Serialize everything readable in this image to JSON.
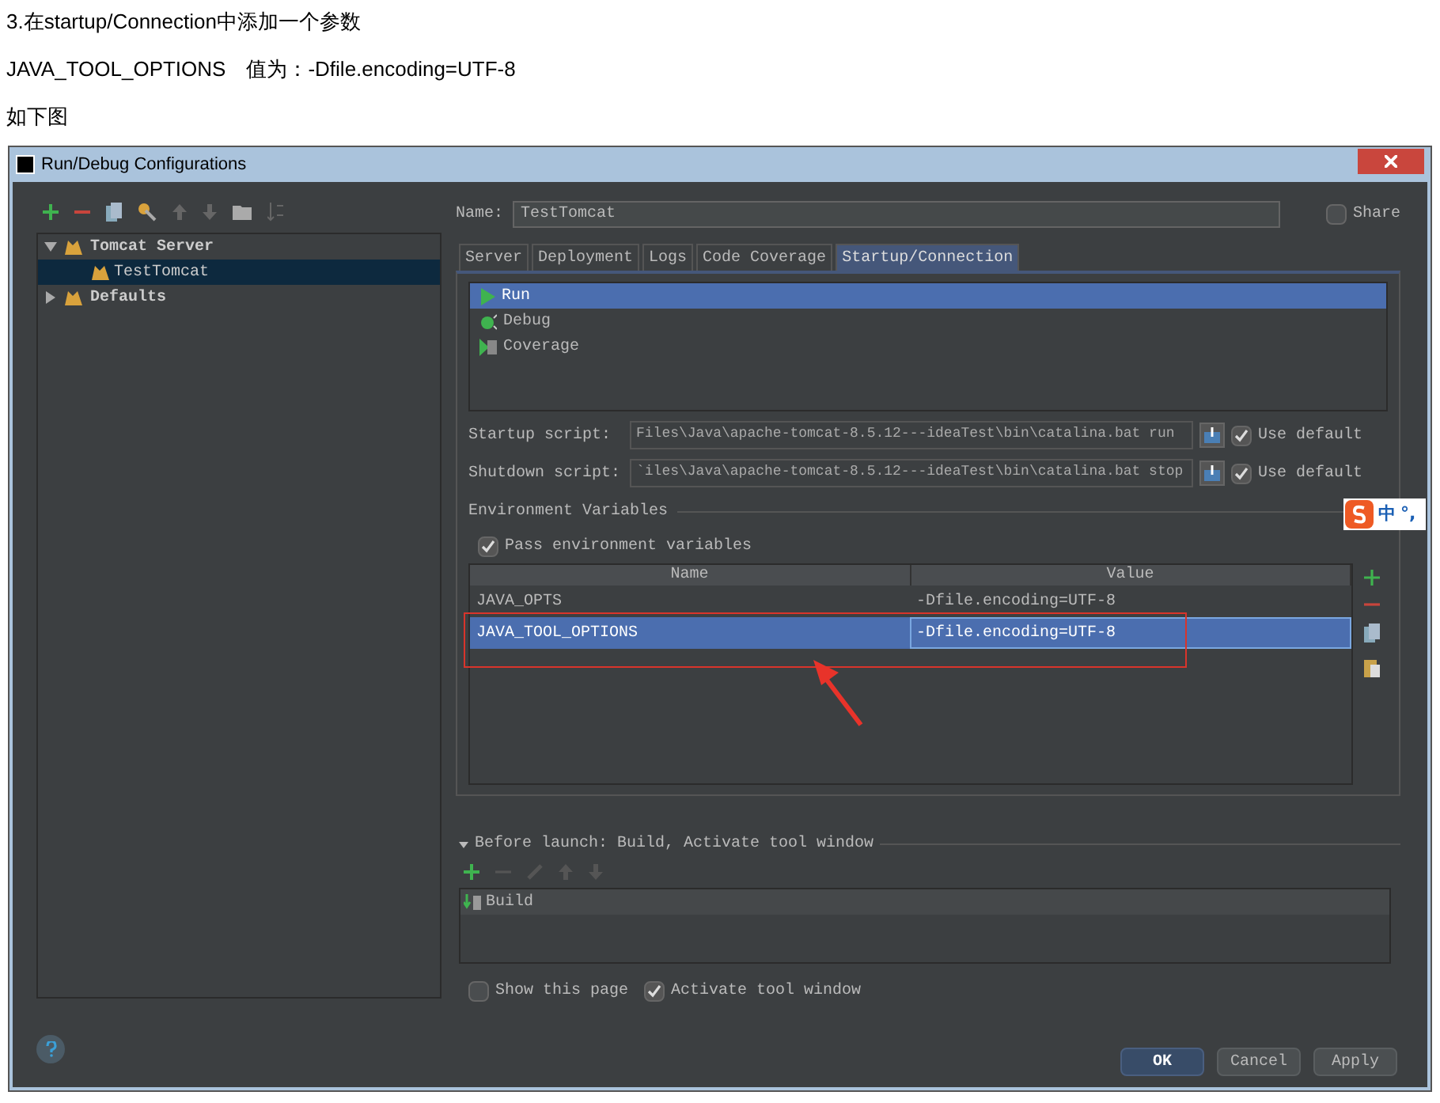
{
  "article": {
    "paragraphs": [
      "3.在startup/Connection中添加一个参数",
      "JAVA_TOOL_OPTIONS　值为：-Dfile.encoding=UTF-8",
      "如下图"
    ]
  },
  "window": {
    "title": "Run/Debug Configurations"
  },
  "tree": [
    {
      "label": "Tomcat Server",
      "expanded": true,
      "selected": false,
      "children": [
        {
          "label": "TestTomcat",
          "selected": true
        }
      ]
    },
    {
      "label": "Defaults",
      "expanded": false,
      "selected": false
    }
  ],
  "name_field": {
    "label": "Name:",
    "value": "TestTomcat"
  },
  "share": {
    "label": "Share",
    "checked": false
  },
  "tabs": [
    {
      "label": "Server",
      "selected": false
    },
    {
      "label": "Deployment",
      "selected": false
    },
    {
      "label": "Logs",
      "selected": false
    },
    {
      "label": "Code Coverage",
      "selected": false
    },
    {
      "label": "Startup/Connection",
      "selected": true
    }
  ],
  "modes": [
    {
      "label": "Run",
      "kind": "run",
      "selected": true
    },
    {
      "label": "Debug",
      "kind": "debug",
      "selected": false
    },
    {
      "label": "Coverage",
      "kind": "coverage",
      "selected": false
    }
  ],
  "scripts": [
    {
      "label": "Startup script:",
      "value": "Files\\Java\\apache-tomcat-8.5.12---ideaTest\\bin\\catalina.bat run",
      "use_default": {
        "label": "Use default",
        "checked": true
      }
    },
    {
      "label": "Shutdown script:",
      "value": "`iles\\Java\\apache-tomcat-8.5.12---ideaTest\\bin\\catalina.bat stop",
      "use_default": {
        "label": "Use default",
        "checked": true
      }
    }
  ],
  "env": {
    "title": "Environment Variables",
    "pass": {
      "label": "Pass environment variables",
      "checked": true
    },
    "columns": [
      "Name",
      "Value"
    ],
    "rows": [
      {
        "name": "JAVA_OPTS",
        "value": "-Dfile.encoding=UTF-8",
        "selected": false
      },
      {
        "name": "JAVA_TOOL_OPTIONS",
        "value": "-Dfile.encoding=UTF-8",
        "selected": true
      }
    ]
  },
  "ime": {
    "mode": "中",
    "punct": "°,"
  },
  "before_launch": {
    "title": "Before launch: Build, Activate tool window",
    "expanded": true,
    "items": [
      "Build"
    ]
  },
  "options": [
    {
      "label": "Show this page",
      "checked": false
    },
    {
      "label": "Activate tool window",
      "checked": true
    }
  ],
  "buttons": [
    {
      "label": "OK",
      "kind": "default"
    },
    {
      "label": "Cancel",
      "kind": "normal"
    },
    {
      "label": "Apply",
      "kind": "normal"
    }
  ]
}
